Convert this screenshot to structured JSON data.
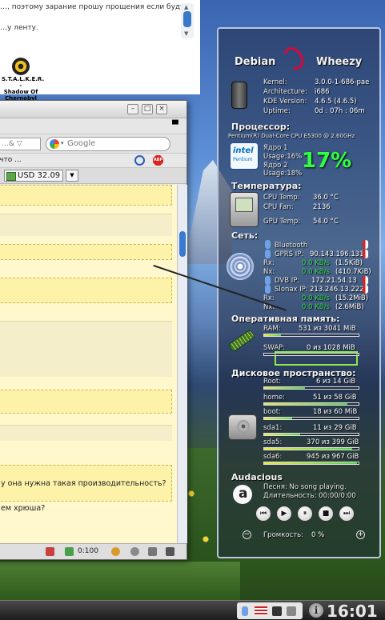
{
  "forum": {
    "line1": "…, поэтому зарание прошу прощения если будут",
    "line2": "…у ленту.",
    "stalker_caption": [
      "S.T.A.L.K.E.R. -",
      "Shadow Of",
      "Chernobyl"
    ]
  },
  "firefox": {
    "search_placeholder": "Google",
    "url_fragment": "…& ▽",
    "bookmark_text": "ь что ...",
    "currency_label": "USD 32.09",
    "posts": [
      {
        "text": ""
      },
      {
        "text": ""
      },
      {
        "text": ""
      },
      {
        "text": ""
      }
    ],
    "text_line1": "у она нужна такая производительность?",
    "text_line2": "ем хрюша?",
    "status_time": "0:100"
  },
  "conky": {
    "distro_left": "Debian",
    "distro_right": "Wheezy",
    "system": [
      {
        "label": "Kernel:",
        "value": "3.0.0-1-686-pae"
      },
      {
        "label": "Architecture:",
        "value": "i686"
      },
      {
        "label": "KDE Version:",
        "value": "4.6.5 (4.6.5)"
      },
      {
        "label": "Uptime:",
        "value": "0d : 07h : 06m"
      }
    ],
    "cpu_title": "Процессор:",
    "cpu_model": "Pentium(R) Dual-Core CPU    E5300 @ 2.60GHz",
    "core1": "Ядро 1",
    "core1_usage": "Usage:16%",
    "core2": "Ядро 2",
    "core2_usage": "Usage:18%",
    "cpu_total": "17%",
    "intel_text": "intel",
    "intel_sub": "Pentium",
    "temp_title": "Температура:",
    "temps": [
      {
        "label": "CPU Temp:",
        "value": "36.0 °C"
      },
      {
        "label": "CPU Fan:",
        "value": "2136"
      },
      {
        "label": "GPU Temp:",
        "value": "54.0 °C"
      }
    ],
    "net_title": "Сеть:",
    "bluetooth": "Bluetooth",
    "gprs_label": "GPRS IP:",
    "gprs_ip": "90.143.196.131",
    "rx_label": "Rx:",
    "tx_label": "Nx:",
    "gprs_rx": "0.0 KB/s",
    "gprs_rx_total": "(1.5KiB)",
    "gprs_tx": "0.0 KB/s",
    "gprs_tx_total": "(410.7KiB)",
    "dvb_label": "DVB IP:",
    "dvb_ip": "172.21.54.13",
    "slonax_label": "Slonax IP:",
    "slonax_ip": "213.246.13.222",
    "dvb_rx": "0.0 KB/s",
    "dvb_rx_total": "(15.2MiB)",
    "dvb_tx": "0.0 KB/s",
    "dvb_tx_total": "(2.6MiB)",
    "ram_title": "Оперативная память:",
    "ram_label": "RAM:",
    "ram_value": "531 из 3041 MiB",
    "ram_fraction": 0.175,
    "swap_label": "SWAP:",
    "swap_value": "0 из 1028 MiB",
    "swap_fraction": 0.0,
    "disk_title": "Дисковое пространство:",
    "disks": [
      {
        "label": "Root:",
        "value": "6 из 14 GiB",
        "fraction": 0.43
      },
      {
        "label": "home:",
        "value": "51 из 58 GiB",
        "fraction": 0.88
      },
      {
        "label": "boot:",
        "value": "18 из 60 MiB",
        "fraction": 0.3
      },
      {
        "label": "sda1:",
        "value": "11 из 29 GiB",
        "fraction": 0.38
      },
      {
        "label": "sda5:",
        "value": "370 из 399 GiB",
        "fraction": 0.93
      },
      {
        "label": "sda6:",
        "value": "945 из 967 GiB",
        "fraction": 0.98
      }
    ],
    "audacious_title": "Audacious",
    "song": "Песня: No song playing.",
    "duration": "Длительность: 00:00/0:00",
    "volume_label": "Громкость:",
    "volume_value": "0    %"
  },
  "taskbar": {
    "clock": "16:01"
  },
  "colors": {
    "accent_green": "#30e050",
    "debian_red": "#d7073c",
    "ram_highlight": "#8fe84f"
  }
}
